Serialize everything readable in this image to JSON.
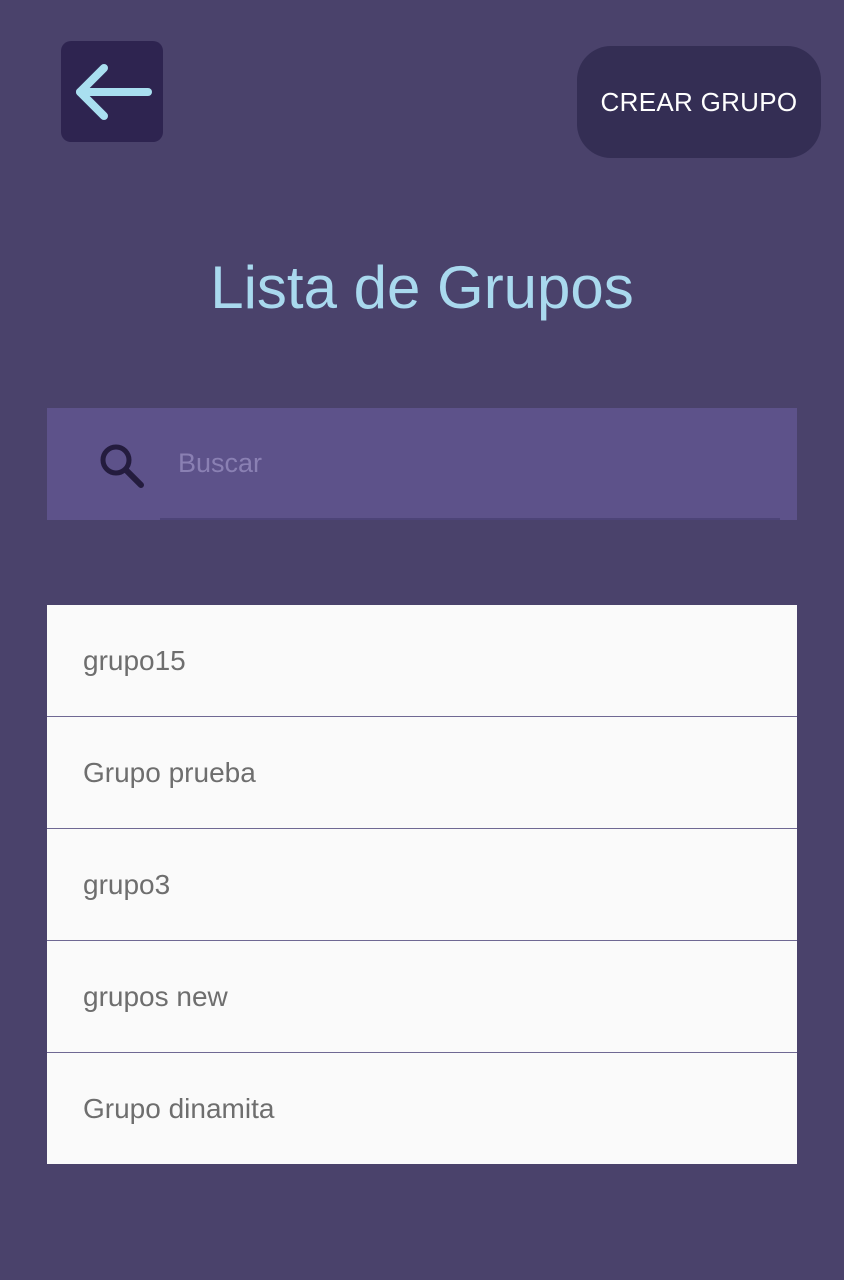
{
  "header": {
    "back_icon": "arrow-left-icon",
    "create_label": "CREAR GRUPO",
    "title": "Lista de Grupos"
  },
  "search": {
    "icon": "search-icon",
    "placeholder": "Buscar",
    "value": ""
  },
  "groups": [
    {
      "name": "grupo15"
    },
    {
      "name": "Grupo prueba"
    },
    {
      "name": "grupo3"
    },
    {
      "name": "grupos new"
    },
    {
      "name": "Grupo dinamita"
    }
  ],
  "colors": {
    "background": "#4a426b",
    "back_button": "#2e2450",
    "create_button": "#342e54",
    "title": "#a9d9ee",
    "search_bar": "#5d528a",
    "list_item": "#fafafa",
    "list_text": "#6e6e6e"
  }
}
